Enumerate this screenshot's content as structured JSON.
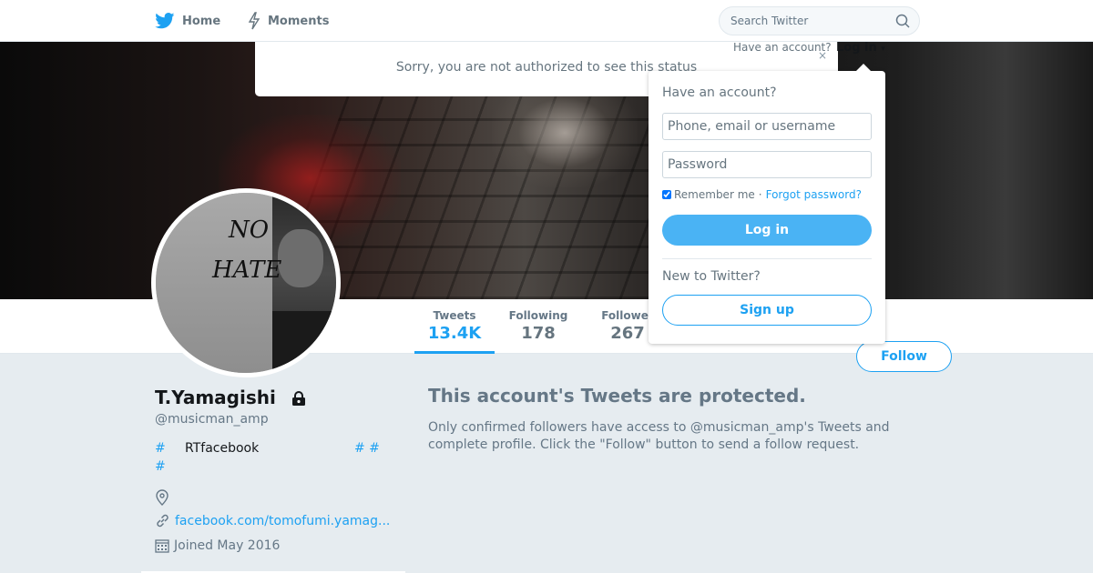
{
  "nav": {
    "home_label": "Home",
    "moments_label": "Moments",
    "search_placeholder": "Search Twitter"
  },
  "banner": {
    "sorry_text": "Sorry, you are not authorized to see this status",
    "close_label": "×"
  },
  "header_login": {
    "have_account": "Have an account?",
    "login_label": "Log in",
    "caret": "▾"
  },
  "login_dropdown": {
    "heading": "Have an account?",
    "username_placeholder": "Phone, email or username",
    "password_placeholder": "Password",
    "remember_label": "Remember me",
    "separator": "·",
    "forgot_label": "Forgot password?",
    "login_button": "Log in",
    "new_heading": "New to Twitter?",
    "signup_button": "Sign up"
  },
  "stats": {
    "tweets_label": "Tweets",
    "tweets_value": "13.4K",
    "following_label": "Following",
    "following_value": "178",
    "followers_label": "Follower",
    "followers_value": "267"
  },
  "follow_button": "Follow",
  "avatar": {
    "text_line1": "NO",
    "text_line2": "HATE"
  },
  "profile": {
    "name": "T.Yamagishi",
    "handle": "@musicman_amp",
    "bio_hash1": "#",
    "bio_text": "RTfacebook",
    "bio_hash2": "# #",
    "bio_hash3": "#",
    "url": "facebook.com/tomofumi.yamag...",
    "joined": "Joined May 2016"
  },
  "protected": {
    "title": "This account's Tweets are protected.",
    "description": "Only confirmed followers have access to @musicman_amp's Tweets and complete profile. Click the \"Follow\" button to send a follow request."
  },
  "colors": {
    "accent": "#1da1f2",
    "background": "#e6ecf0",
    "muted_text": "#657786"
  },
  "icons": {
    "home": "twitter-bird-icon",
    "moments": "lightning-icon",
    "search": "search-icon",
    "lock": "lock-icon",
    "location": "location-pin-icon",
    "link": "link-icon",
    "calendar": "calendar-icon"
  }
}
